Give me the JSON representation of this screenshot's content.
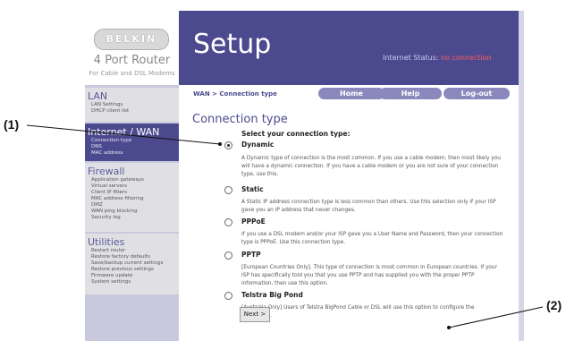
{
  "brand": {
    "logo_text": "BELKIN",
    "product": "4 Port Router",
    "product_sub": "For Cable and DSL Modems"
  },
  "header": {
    "title": "Setup",
    "status_label": "Internet Status:",
    "status_value": "no connection"
  },
  "sidebar": {
    "groups": [
      {
        "title": "LAN",
        "items": [
          "LAN Settings",
          "DHCP client list"
        ]
      },
      {
        "title": "Internet / WAN",
        "items": [
          "Connection type",
          "DNS",
          "MAC address"
        ]
      },
      {
        "title": "Firewall",
        "items": [
          "Application gateways",
          "Virtual servers",
          "Client IP filters",
          "MAC address filtering",
          "DMZ",
          "WAN ping blocking",
          "Security log"
        ]
      },
      {
        "title": "Utilities",
        "items": [
          "Restart router",
          "Restore factory defaults",
          "Save/backup current settings",
          "Restore previous settings",
          "Firmware update",
          "System settings"
        ]
      }
    ]
  },
  "toolbar": {
    "breadcrumb": "WAN > Connection type",
    "home": "Home",
    "help": "Help",
    "logout": "Log-out"
  },
  "main": {
    "title": "Connection type",
    "prompt": "Select your connection type:",
    "options": [
      {
        "label": "Dynamic",
        "checked": true,
        "desc": "A Dynamic type of connection is the most common. If you use a cable modem, then most likely you will have a dynamic connection. If you have a cable modem or you are not sure of your connection type, use this."
      },
      {
        "label": "Static",
        "checked": false,
        "desc": "A Static IP address connection type is less common than others. Use this selection only if your ISP gave you an IP address that never changes."
      },
      {
        "label": "PPPoE",
        "checked": false,
        "desc": "If you use a DSL modem and/or your ISP gave you a User Name and Password, then your connection type is PPPoE. Use this connection type."
      },
      {
        "label": "PPTP",
        "checked": false,
        "desc": "[European Countries Only]. This type of connection is most common in European countries. If your ISP has specifically told you that you use PPTP and has supplied you with the proper PPTP information, then use this option."
      },
      {
        "label": "Telstra Big Pond",
        "checked": false,
        "desc": "[Australia Only] Users of Telstra BigPond Cable or DSL will use this option to configure the connection."
      }
    ],
    "next_label": "Next >"
  },
  "annotations": {
    "callout_1": "(1)",
    "callout_2": "(2)"
  },
  "colors": {
    "header_bg": "#4c4a8e",
    "status_alert": "#ff5a5a",
    "button_bg": "#8a88bd"
  }
}
